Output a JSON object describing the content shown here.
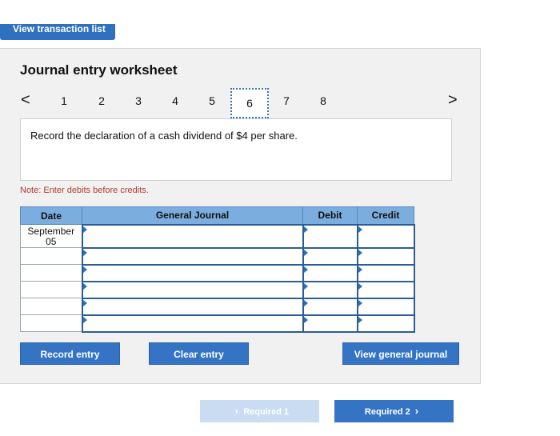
{
  "top_button": {
    "label": "View transaction list"
  },
  "worksheet": {
    "title": "Journal entry worksheet",
    "pages": [
      "1",
      "2",
      "3",
      "4",
      "5",
      "6",
      "7",
      "8"
    ],
    "active_page": "6",
    "prev_arrow": "<",
    "next_arrow": ">",
    "prompt": "Record the declaration of a cash dividend of $4 per share.",
    "note": "Note: Enter debits before credits."
  },
  "journal": {
    "headers": {
      "date": "Date",
      "account": "General Journal",
      "debit": "Debit",
      "credit": "Credit"
    },
    "first_date": "September\n05",
    "rows": 6
  },
  "actions": {
    "record": "Record entry",
    "clear": "Clear entry",
    "view_journal": "View general journal"
  },
  "nav": {
    "prev_label": "Required 1",
    "next_label": "Required 2",
    "prev_icon": "chevron-left-icon",
    "next_icon": "chevron-right-icon"
  },
  "colors": {
    "accent": "#3574c4",
    "header": "#7badde",
    "note": "#b03a2e"
  }
}
